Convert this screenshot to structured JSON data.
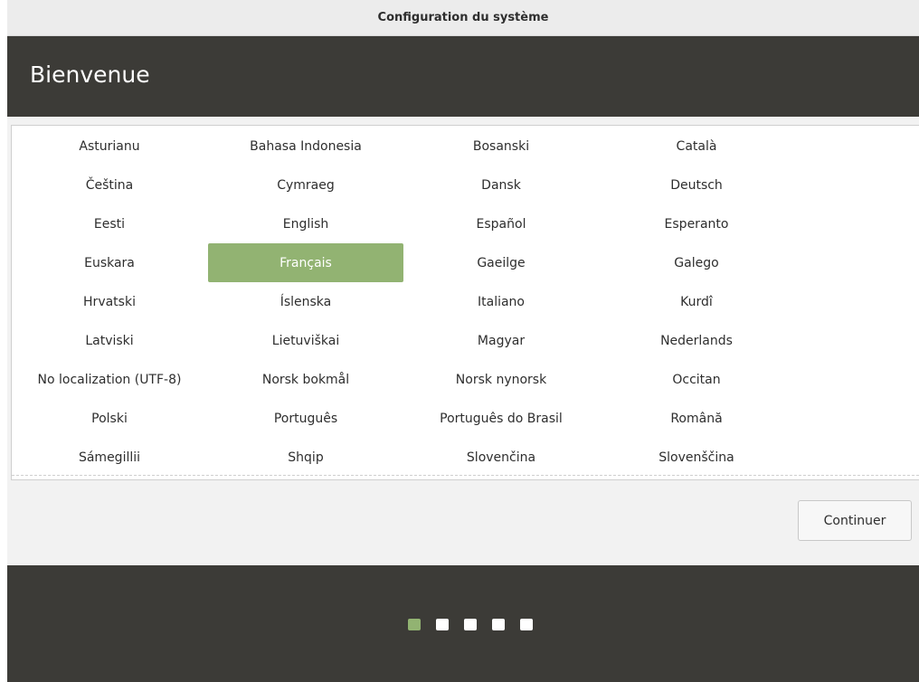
{
  "window": {
    "title": "Configuration du système"
  },
  "header": {
    "title": "Bienvenue"
  },
  "languages": {
    "selected": "Français",
    "items": [
      "Asturianu",
      "Bahasa Indonesia",
      "Bosanski",
      "Català",
      "Čeština",
      "Cymraeg",
      "Dansk",
      "Deutsch",
      "Eesti",
      "English",
      "Español",
      "Esperanto",
      "Euskara",
      "Français",
      "Gaeilge",
      "Galego",
      "Hrvatski",
      "Íslenska",
      "Italiano",
      "Kurdî",
      "Latviski",
      "Lietuviškai",
      "Magyar",
      "Nederlands",
      "No localization (UTF-8)",
      "Norsk bokmål",
      "Norsk nynorsk",
      "Occitan",
      "Polski",
      "Português",
      "Português do Brasil",
      "Română",
      "Sámegillii",
      "Shqip",
      "Slovenčina",
      "Slovenščina"
    ]
  },
  "actions": {
    "continue_label": "Continuer"
  },
  "progress": {
    "total_steps": 5,
    "current_step": 1
  },
  "colors": {
    "accent": "#92b372",
    "dark": "#3c3b37"
  }
}
